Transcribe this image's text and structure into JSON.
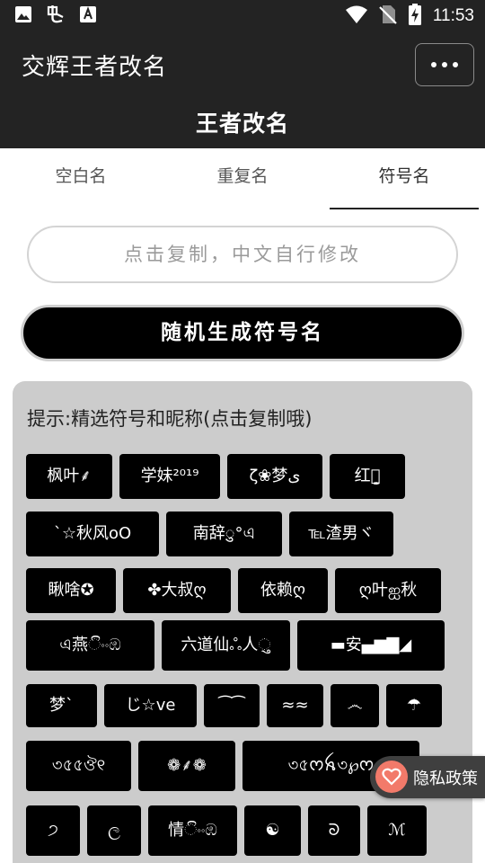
{
  "status_bar": {
    "time": "11:53",
    "icons": [
      "image-icon",
      "app-notification-icon",
      "font-app-icon",
      "wifi-icon",
      "no-sim-icon",
      "battery-charging-icon"
    ]
  },
  "app_bar": {
    "title": "交辉王者改名",
    "more_icon": "more-dots-icon"
  },
  "page": {
    "title": "王者改名"
  },
  "tabs": [
    {
      "label": "空白名",
      "active": false
    },
    {
      "label": "重复名",
      "active": false
    },
    {
      "label": "符号名",
      "active": true
    }
  ],
  "copy_field": {
    "placeholder": "点击复制，中文自行修改",
    "value": ""
  },
  "generate_button": {
    "label": "随机生成符号名"
  },
  "panel": {
    "tip": "提示:精选符号和昵称(点击复制哦)",
    "rows": [
      [
        "枫叶⸙",
        "学妹²⁰¹⁹",
        "ζ❀梦ى",
        "红颜̮̯"
      ],
      [
        "ˋ☆秋风oO",
        "南辞ु°এ",
        "℡渣男ヾ"
      ],
      [
        "瞅啥✪",
        "✤大叔ღ",
        "依赖ღ",
        "ღ叶ஐ秋"
      ],
      [
        "এ燕ිංංඹ",
        "六道仙ஃ人ુ",
        "▬安▄▆▇◢"
      ],
      [
        "梦ˋ",
        "じ☆ve",
        "⁀⁀",
        "≈≈",
        "෴",
        "☂"
      ],
      [
        "৩৫৫ঔ୧",
        "❁⸙❁",
        "৩৫ᰔꫝ৩℘ᰔ"
      ],
      [
        "੭",
        "ල",
        "情ිංංඹ",
        "☯",
        "ᘐ",
        "ℳ"
      ]
    ]
  },
  "privacy": {
    "label": "隐私政策",
    "icon": "heart-icon"
  }
}
